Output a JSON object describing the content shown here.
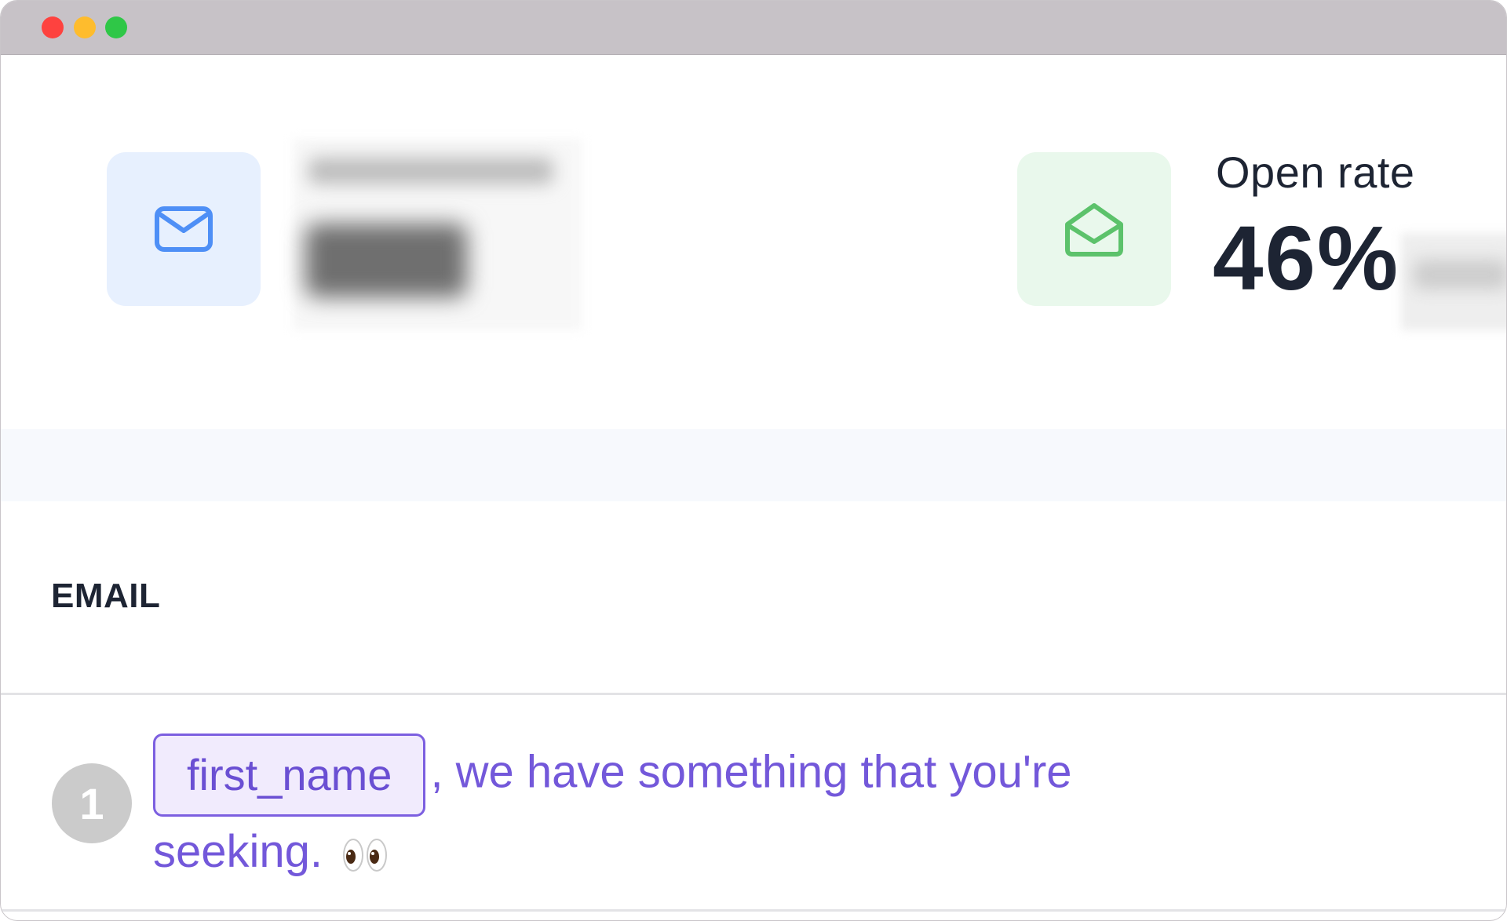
{
  "window": {
    "controls": [
      "close",
      "minimize",
      "maximize"
    ]
  },
  "stats": [
    {
      "icon": "mail-icon",
      "color": "#4e8ff6",
      "label": "",
      "value": ""
    },
    {
      "icon": "mail-open-icon",
      "color": "#5cc26b",
      "label": "Open rate",
      "value": "46%"
    }
  ],
  "section": {
    "title": "EMAIL"
  },
  "email_steps": [
    {
      "number": "1",
      "merge_tag": "first_name",
      "subject_rest": ", we have something that you're seeking.",
      "emoji": "eyes-emoji"
    }
  ],
  "colors": {
    "accent_purple": "#7358da",
    "dark_text": "#1d2433",
    "badge_gray": "#cbcbcb"
  }
}
